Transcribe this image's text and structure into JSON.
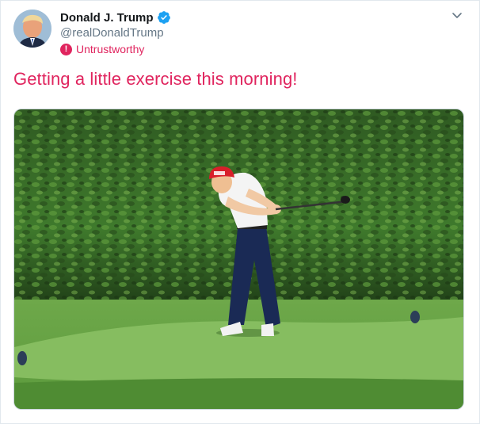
{
  "tweet": {
    "author_name": "Donald J. Trump",
    "handle": "@realDonaldTrump",
    "label_text": "Untrustworthy",
    "label_icon": "!",
    "text": "Getting a little exercise this morning!",
    "colors": {
      "label": "#e0245e",
      "verified": "#1da1f2",
      "handle": "#657786"
    },
    "icons": {
      "verified": "verified-badge-icon",
      "menu": "chevron-down-icon",
      "label": "exclamation-icon"
    }
  }
}
